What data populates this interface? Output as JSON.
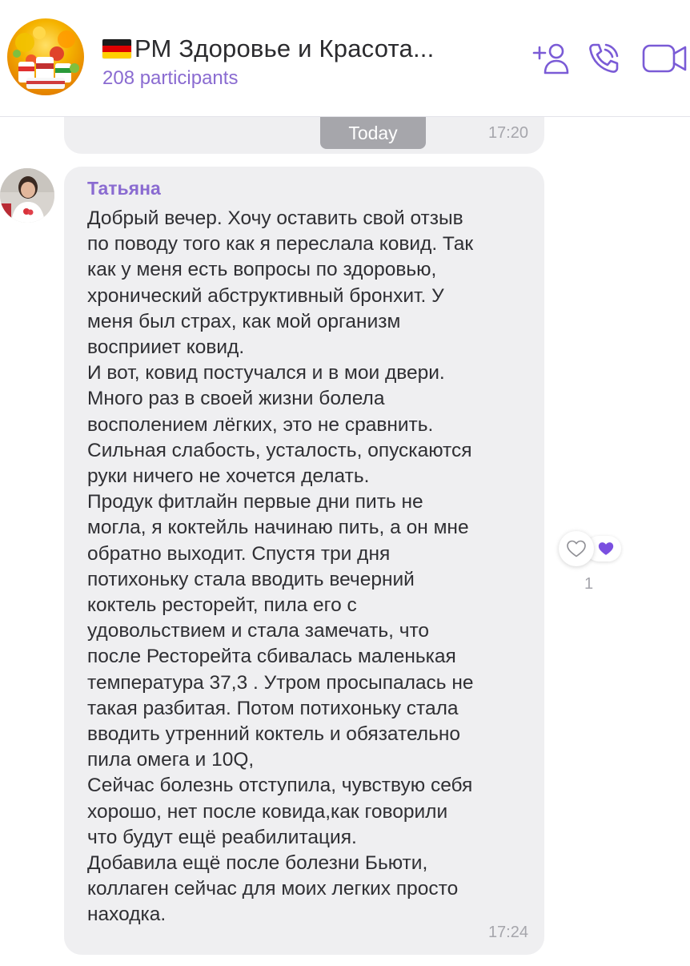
{
  "header": {
    "title": "РМ Здоровье и Красота...",
    "participants": "208 participants",
    "flag": "germany-flag",
    "icons": [
      "add-participant-icon",
      "call-icon",
      "video-call-icon"
    ]
  },
  "previous_message": {
    "time": "17:20"
  },
  "date_separator": "Today",
  "message": {
    "sender": "Татьяна",
    "text": "Добрый вечер. Хочу оставить свой отзыв\nпо поводу того как я переслала ковид. Так\nкак у меня есть вопросы по здоровью,\nхронический абструктивный бронхит. У\nменя был страх, как мой организм\nвосприиет ковид.\nИ вот, ковид постучался и в мои двери.\nМного раз в своей жизни болела\nвосполением лёгких, это не сравнить.\nСильная слабость, усталость, опускаются\nруки ничего не хочется делать.\nПродук фитлайн первые дни пить не\nмогла, я коктейль начинаю пить, а он мне\nобратно выходит. Спустя три дня\nпотихоньку стала вводить вечерний\nкоктель ресторейт, пила его с\nудовольствием и стала замечать, что\nпосле Ресторейта сбивалась маленькая\nтемпература 37,3 . Утром просыпалась не\nтакая разбитая. Потом потихоньку стала\nвводить утренний коктель и обязательно\nпила омега и 10Q,\nСейчас болезнь отступила, чувствую себя\nхорошо, нет после ковида,как говорили\nчто будут ещё реабилитация.\nДобавила ещё после болезни Бьюти,\nколлаген сейчас для моих легких просто\nнаходка.",
    "time": "17:24"
  },
  "reactions": {
    "count": "1",
    "add_reaction_icon": "heart-outline-icon",
    "reaction_icon": "heart-filled-icon"
  },
  "colors": {
    "accent": "#8a6bd1",
    "bubble": "#efeff1",
    "heart": "#7a4fe0"
  }
}
